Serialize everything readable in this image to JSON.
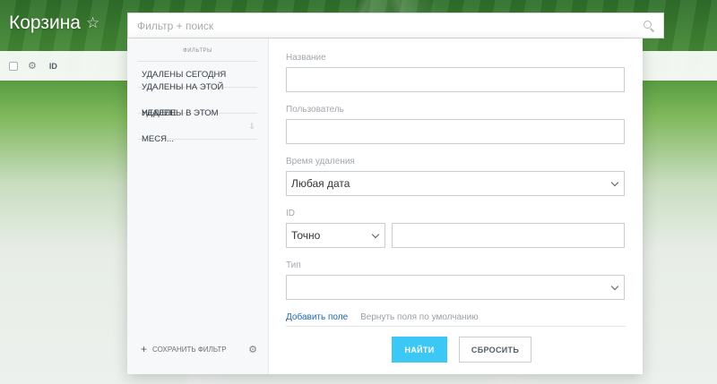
{
  "header": {
    "title": "Корзина",
    "search_placeholder": "Фильтр + поиск"
  },
  "grid": {
    "id_column": "ID"
  },
  "filter_popup": {
    "sidebar": {
      "header": "ФИЛЬТРЫ",
      "items": [
        {
          "label": "УДАЛЕНЫ СЕГОДНЯ"
        },
        {
          "label": "УДАЛЕНЫ НА ЭТОЙ НЕДЕЛЕ"
        },
        {
          "label": "УДАЛЕНЫ В ЭТОМ МЕСЯ..."
        }
      ],
      "save_filter_label": "СОХРАНИТЬ ФИЛЬТР"
    },
    "fields": {
      "name_label": "Название",
      "name_value": "",
      "user_label": "Пользователь",
      "user_value": "",
      "deletion_time_label": "Время удаления",
      "deletion_time_value": "Любая дата",
      "id_label": "ID",
      "id_mode_value": "Точно",
      "id_value": "",
      "type_label": "Тип",
      "type_value": ""
    },
    "links": {
      "add_field": "Добавить поле",
      "restore_defaults": "Вернуть поля по умолчанию"
    },
    "buttons": {
      "find": "НАЙТИ",
      "reset": "СБРОСИТЬ"
    }
  },
  "colors": {
    "accent": "#3bc8f5",
    "link": "#1f67b0",
    "border": "#c6cdd3"
  }
}
